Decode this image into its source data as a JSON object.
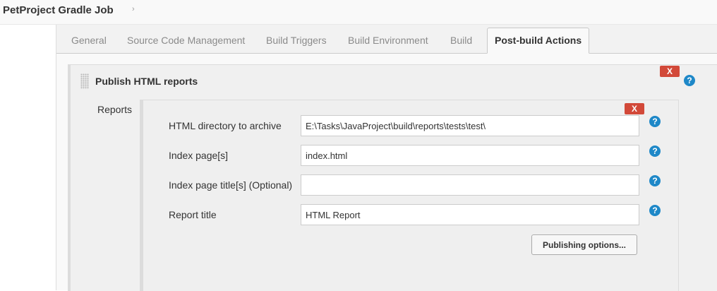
{
  "breadcrumb": {
    "job_title": "PetProject Gradle Job",
    "arrow": "›"
  },
  "tabs": [
    {
      "label": "General"
    },
    {
      "label": "Source Code Management"
    },
    {
      "label": "Build Triggers"
    },
    {
      "label": "Build Environment"
    },
    {
      "label": "Build"
    },
    {
      "label": "Post-build Actions",
      "active": true
    }
  ],
  "section": {
    "title": "Publish HTML reports",
    "delete_label": "X",
    "help": "?",
    "reports_label": "Reports"
  },
  "report": {
    "delete_label": "X",
    "help": "?",
    "fields": [
      {
        "label": "HTML directory to archive",
        "value": "E:\\Tasks\\JavaProject\\build\\reports\\tests\\test\\"
      },
      {
        "label": "Index page[s]",
        "value": "index.html"
      },
      {
        "label": "Index page title[s] (Optional)",
        "value": ""
      },
      {
        "label": "Report title",
        "value": "HTML Report"
      }
    ],
    "publishing_options_label": "Publishing options..."
  },
  "colors": {
    "delete": "#d24939",
    "help": "#1e88c8"
  },
  "icons": {
    "delete": "x-icon",
    "help": "help-icon",
    "drag": "drag-handle-icon",
    "breadcrumb": "chevron-right-icon"
  }
}
